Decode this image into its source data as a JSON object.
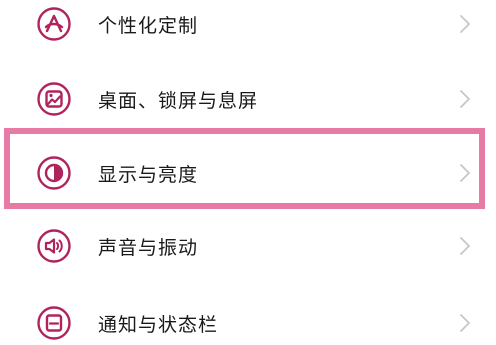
{
  "settings": {
    "items": [
      {
        "label": "个性化定制",
        "icon": "personalize-icon"
      },
      {
        "label": "桌面、锁屏与息屏",
        "icon": "wallpaper-icon"
      },
      {
        "label": "显示与亮度",
        "icon": "brightness-icon",
        "highlighted": true
      },
      {
        "label": "声音与振动",
        "icon": "sound-icon"
      },
      {
        "label": "通知与状态栏",
        "icon": "notification-icon"
      }
    ]
  },
  "colors": {
    "icon": "#b0245e",
    "text": "#1a1a1a",
    "chevron": "#c6c6c6",
    "highlight_border": "#e87ba6"
  }
}
